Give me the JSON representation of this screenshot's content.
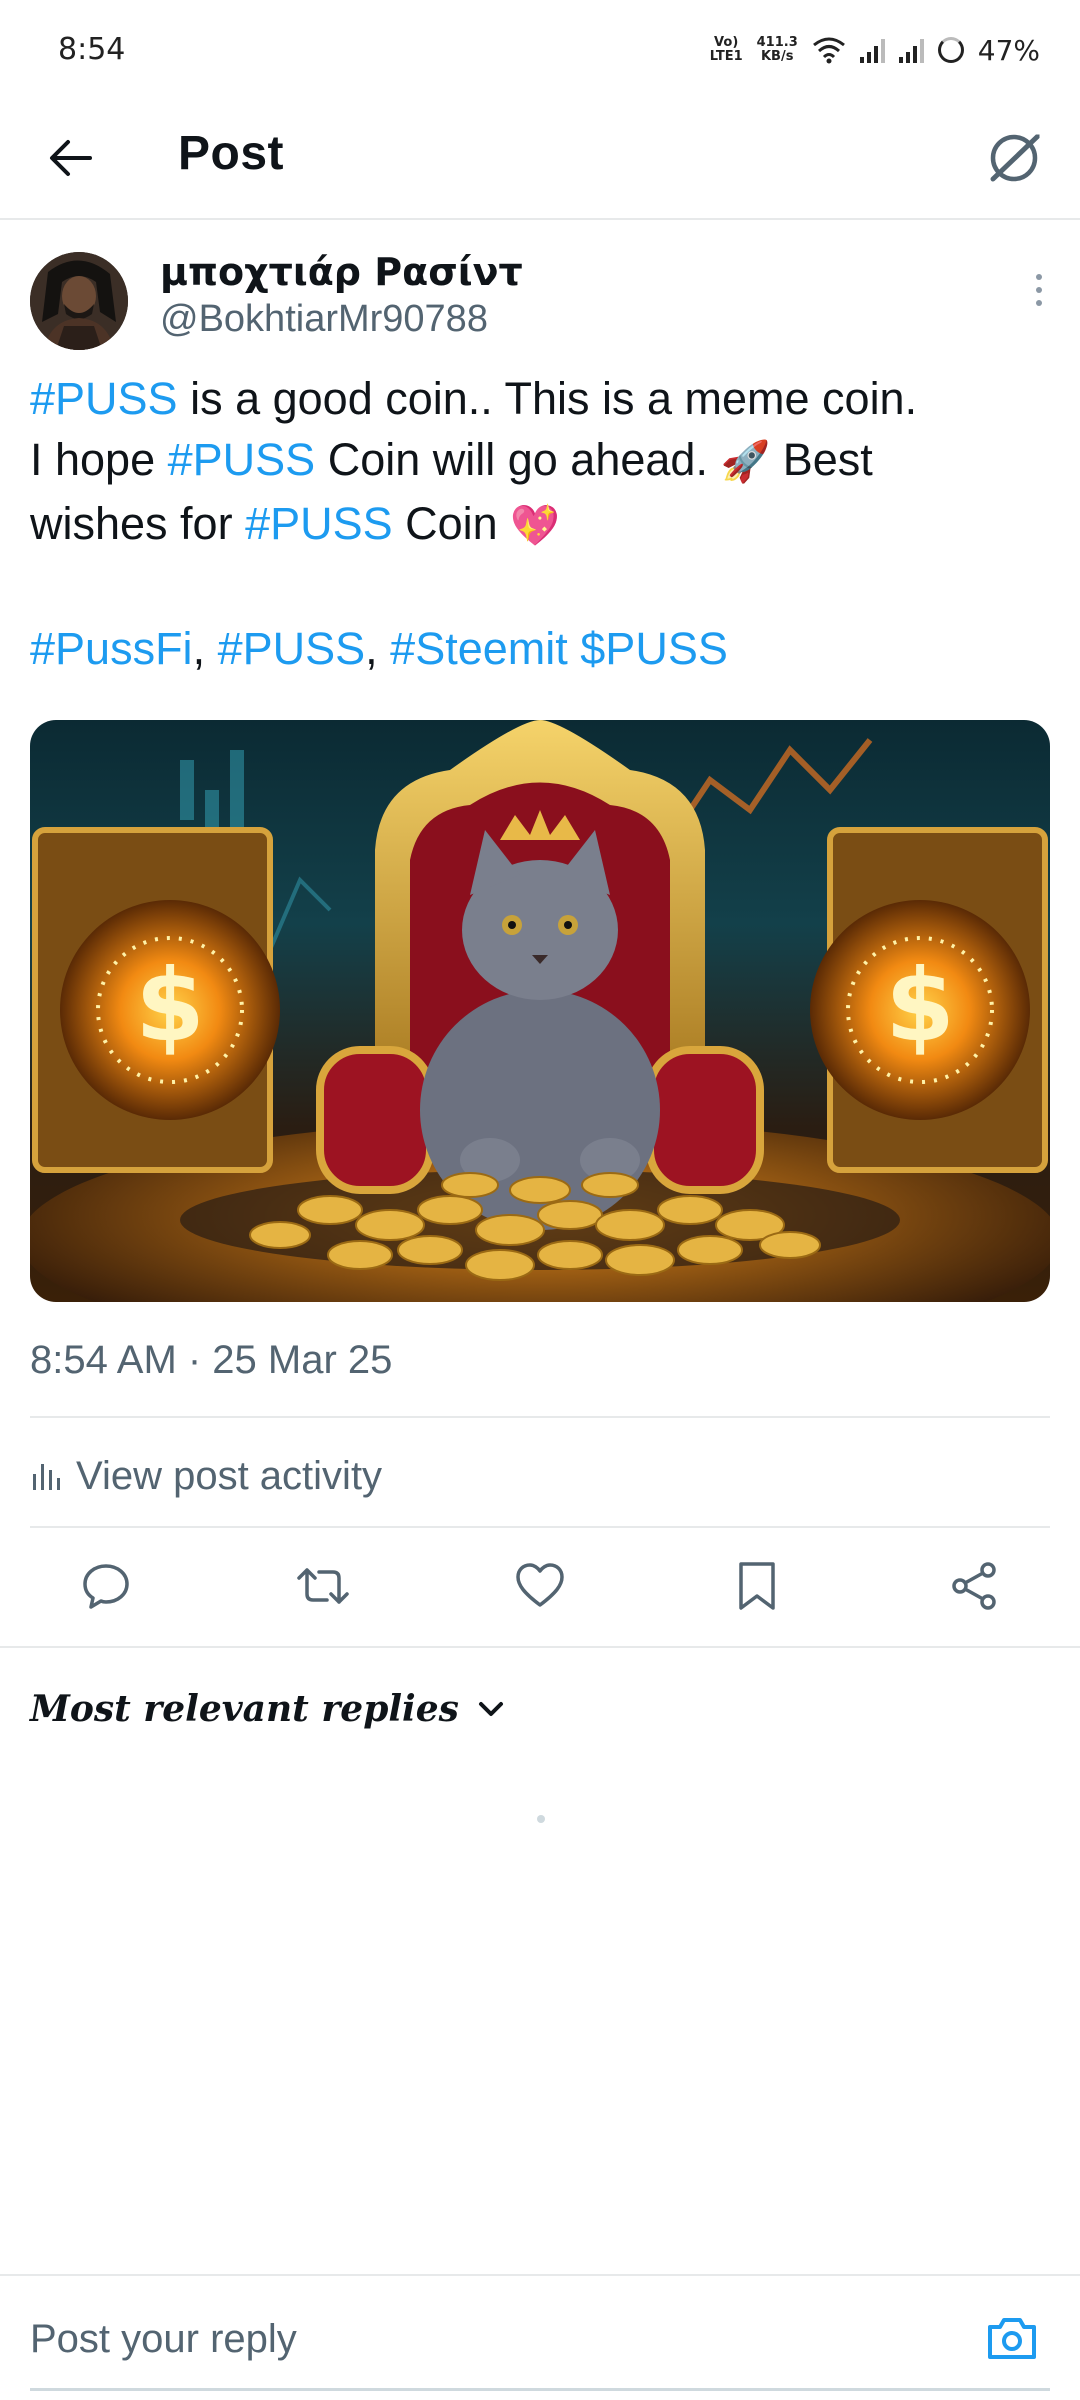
{
  "status_bar": {
    "time": "8:54",
    "volte_top": "Vo)",
    "volte_bottom": "LTE1",
    "speed_value": "411.3",
    "speed_unit": "KB/s",
    "battery": "47%"
  },
  "header": {
    "title": "Post",
    "back_icon": "arrow-left-icon",
    "grok_icon": "grok-icon"
  },
  "post": {
    "author": {
      "display_name": "μποχτιάρ Ρασίντ",
      "handle": "@BokhtiarMr90788"
    },
    "text": {
      "line1_tag": "#PUSS",
      "line1_rest": " is a good coin.. This is a meme coin.",
      "line2_start": "I hope ",
      "line2_tag": "#PUSS",
      "line2_rest": " Coin will go ahead. ",
      "rocket_emoji": "🚀",
      "line2_end": " Best",
      "line3_start": "wishes for ",
      "line3_tag": "#PUSS",
      "line3_rest": " Coin ",
      "heart_emoji": "💖",
      "tags": [
        "#PussFi",
        "#PUSS",
        "#Steemit",
        "$PUSS"
      ],
      "comma": ", "
    },
    "media_icon": "cat-on-throne-image",
    "timestamp": "8:54 AM · 25 Mar 25",
    "activity_label": "View post activity",
    "actions": [
      {
        "name": "reply-icon"
      },
      {
        "name": "repost-icon"
      },
      {
        "name": "like-icon"
      },
      {
        "name": "bookmark-icon"
      },
      {
        "name": "share-icon"
      }
    ]
  },
  "replies": {
    "sort_label": "Most relevant replies"
  },
  "reply_bar": {
    "placeholder": "Post your reply"
  },
  "colors": {
    "link": "#1d9bf0",
    "secondary_text": "#536471",
    "divider": "#e7e9ea"
  }
}
